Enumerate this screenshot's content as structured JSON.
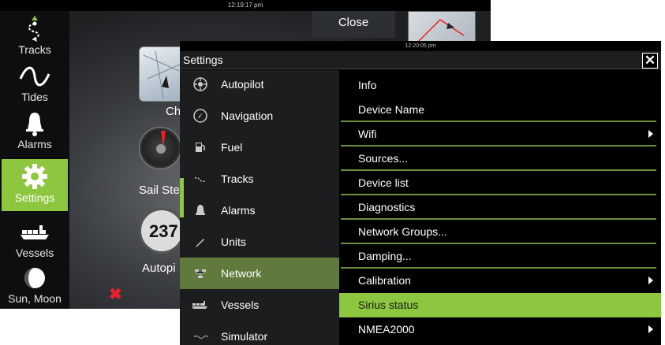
{
  "background_screen": {
    "clock": "12:19:17 pm",
    "close_label": "Close",
    "sidebar": [
      {
        "label": "Tracks",
        "icon": "tracks-icon"
      },
      {
        "label": "Tides",
        "icon": "tides-icon"
      },
      {
        "label": "Alarms",
        "icon": "bell-icon"
      },
      {
        "label": "Settings",
        "icon": "gear-icon"
      },
      {
        "label": "Vessels",
        "icon": "vessels-icon"
      },
      {
        "label": "Sun, Moon",
        "icon": "moon-icon"
      }
    ],
    "active_sidebar_item": "Settings",
    "tiles": [
      {
        "label": "Char"
      },
      {
        "label": "Sail Ste"
      },
      {
        "label": "Autopi",
        "readout": "237"
      }
    ]
  },
  "settings_dialog": {
    "clock": "12:20:05 pm",
    "title": "Settings",
    "close_icon": "close-icon",
    "menu": [
      {
        "label": "Autopilot",
        "icon": "autopilot-icon"
      },
      {
        "label": "Navigation",
        "icon": "compass-icon"
      },
      {
        "label": "Fuel",
        "icon": "fuel-icon"
      },
      {
        "label": "Tracks",
        "icon": "tracks-icon"
      },
      {
        "label": "Alarms",
        "icon": "bell-icon"
      },
      {
        "label": "Units",
        "icon": "pencil-icon"
      },
      {
        "label": "Network",
        "icon": "network-icon"
      },
      {
        "label": "Vessels",
        "icon": "vessels-icon"
      },
      {
        "label": "Simulator",
        "icon": "simulator-icon"
      }
    ],
    "selected_menu_item": "Network",
    "options": [
      {
        "label": "Info",
        "has_submenu": false
      },
      {
        "label": "Device Name",
        "has_submenu": false
      },
      {
        "label": "Wifi",
        "has_submenu": true
      },
      {
        "label": "Sources...",
        "has_submenu": false
      },
      {
        "label": "Device list",
        "has_submenu": false
      },
      {
        "label": "Diagnostics",
        "has_submenu": false
      },
      {
        "label": "Network Groups...",
        "has_submenu": false
      },
      {
        "label": "Damping...",
        "has_submenu": false
      },
      {
        "label": "Calibration",
        "has_submenu": true
      },
      {
        "label": "Sirius status",
        "has_submenu": false
      },
      {
        "label": "NMEA2000",
        "has_submenu": true
      }
    ],
    "highlighted_option": "Sirius status"
  },
  "colors": {
    "accent_green": "#8dc63f",
    "selected_menu_bg": "#5f7a3c",
    "separator_green": "#6b8e3a",
    "alert_red": "#e8212a"
  }
}
